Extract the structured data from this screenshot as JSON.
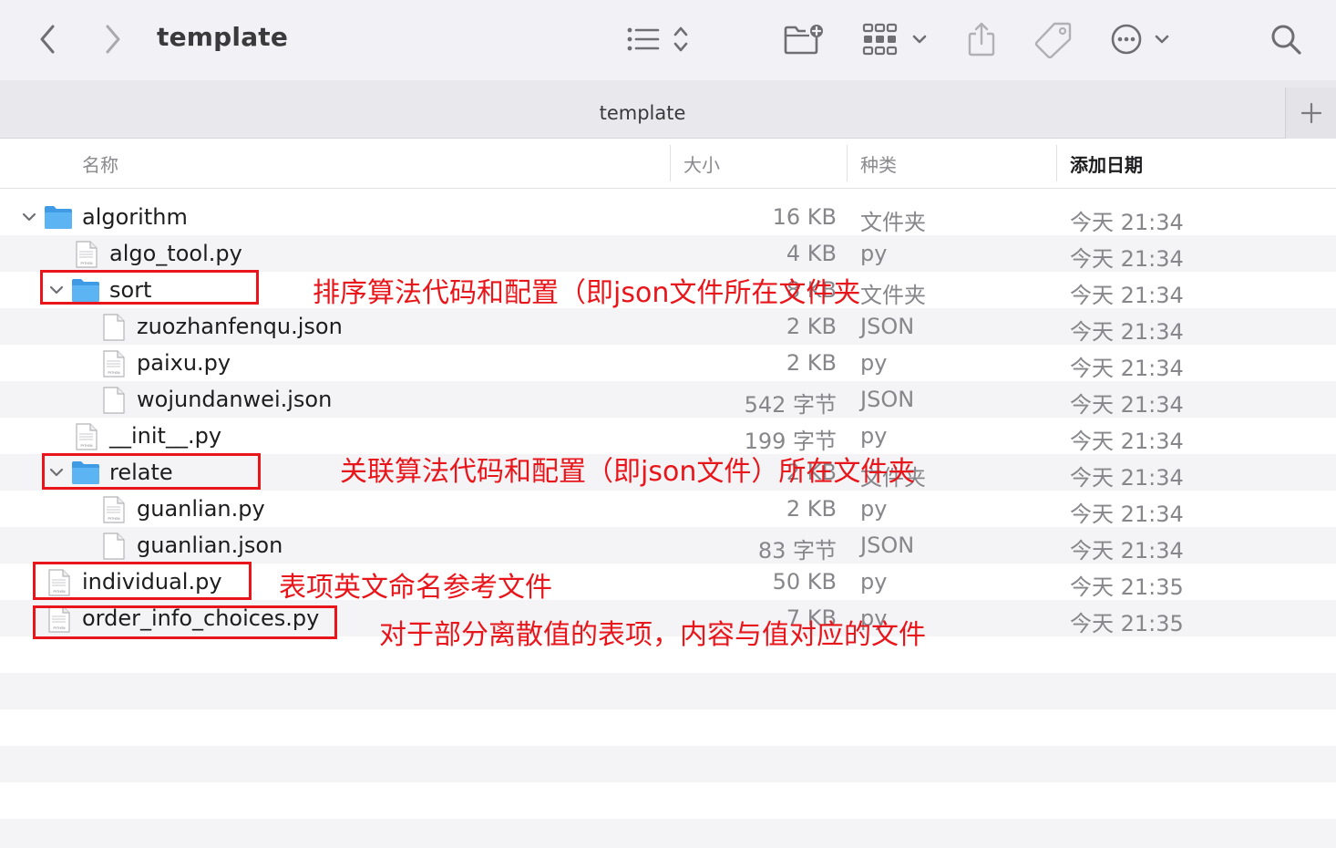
{
  "window": {
    "title": "template",
    "tab_title": "template"
  },
  "columns": {
    "name": "名称",
    "size": "大小",
    "kind": "种类",
    "date_added": "添加日期"
  },
  "rows": [
    {
      "name": "algorithm",
      "size": "16 KB",
      "kind": "文件夹",
      "date": "今天 21:34"
    },
    {
      "name": "algo_tool.py",
      "size": "4 KB",
      "kind": "py",
      "date": "今天 21:34"
    },
    {
      "name": "sort",
      "size": "8 KB",
      "kind": "文件夹",
      "date": "今天 21:34"
    },
    {
      "name": "zuozhanfenqu.json",
      "size": "2 KB",
      "kind": "JSON",
      "date": "今天 21:34"
    },
    {
      "name": "paixu.py",
      "size": "2 KB",
      "kind": "py",
      "date": "今天 21:34"
    },
    {
      "name": "wojundanwei.json",
      "size": "542 字节",
      "kind": "JSON",
      "date": "今天 21:34"
    },
    {
      "name": "__init__.py",
      "size": "199 字节",
      "kind": "py",
      "date": "今天 21:34"
    },
    {
      "name": "relate",
      "size": "2 KB",
      "kind": "文件夹",
      "date": "今天 21:34"
    },
    {
      "name": "guanlian.py",
      "size": "2 KB",
      "kind": "py",
      "date": "今天 21:34"
    },
    {
      "name": "guanlian.json",
      "size": "83 字节",
      "kind": "JSON",
      "date": "今天 21:34"
    },
    {
      "name": "individual.py",
      "size": "50 KB",
      "kind": "py",
      "date": "今天 21:35"
    },
    {
      "name": "order_info_choices.py",
      "size": "7 KB",
      "kind": "py",
      "date": "今天 21:35"
    }
  ],
  "annotations": {
    "sort_note": "排序算法代码和配置（即json文件所在文件夹",
    "relate_note": "关联算法代码和配置（即json文件）所在文件夹",
    "individual_note": "表项英文命名参考文件",
    "order_note": "对于部分离散值的表项，内容与值对应的文件"
  },
  "icon_text": {
    "python_badge": "PYTHON"
  },
  "icons": [
    "chevron-left-icon",
    "chevron-right-icon",
    "list-view-icon",
    "new-folder-icon",
    "group-grid-icon",
    "share-icon",
    "tag-icon",
    "more-icon",
    "search-icon",
    "plus-icon",
    "folder-icon",
    "python-file-icon",
    "json-file-icon"
  ],
  "colors": {
    "annotation": "#e8161b",
    "folder": "#4aa8ee",
    "toolbar_bg": "#f2f1f5"
  }
}
